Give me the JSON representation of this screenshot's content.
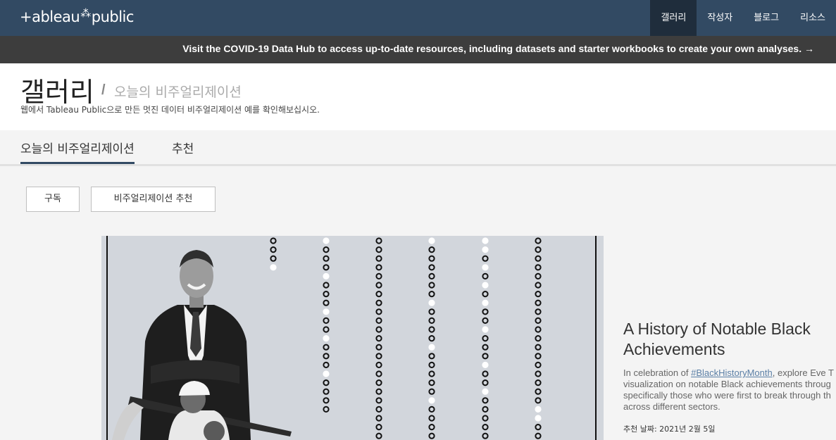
{
  "header": {
    "logo_text_left": "+ableau",
    "logo_text_right": "public",
    "nav": [
      {
        "label": "갤러리",
        "active": true
      },
      {
        "label": "작성자",
        "active": false
      },
      {
        "label": "블로그",
        "active": false
      },
      {
        "label": "리소스",
        "active": false
      }
    ]
  },
  "banner": {
    "text": "Visit the COVID-19 Data Hub to access up-to-date resources, including datasets and starter workbooks to create your own analyses. →"
  },
  "page": {
    "title": "갤러리",
    "separator": "/",
    "crumb": "오늘의 비주얼리제이션",
    "description": "웹에서 Tableau Public으로 만든 멋진 데이터 비주얼리제이션 예를 확인해보십시오."
  },
  "tabs": [
    {
      "label": "오늘의 비주얼리제이션",
      "active": true
    },
    {
      "label": "추천",
      "active": false
    }
  ],
  "buttons": {
    "subscribe": "구독",
    "recommend": "비주얼리제이션 추천"
  },
  "featured": {
    "title": "A History of Notable Black Achievements",
    "desc_prefix": "In celebration of ",
    "desc_link": "#BlackHistoryMonth",
    "desc_line1_suffix": ", explore Eve T",
    "desc_line2": "visualization on notable Black achievements throug",
    "desc_line3": "specifically those who were first to break through th",
    "desc_line4": "across different sectors.",
    "date": "추천 날짜: 2021년 2월 5일"
  },
  "colors": {
    "nav_bg": "#324a63",
    "nav_active_bg": "#1f2d3c",
    "banner_bg": "#3d3d3d",
    "link": "#5b7fa6"
  }
}
